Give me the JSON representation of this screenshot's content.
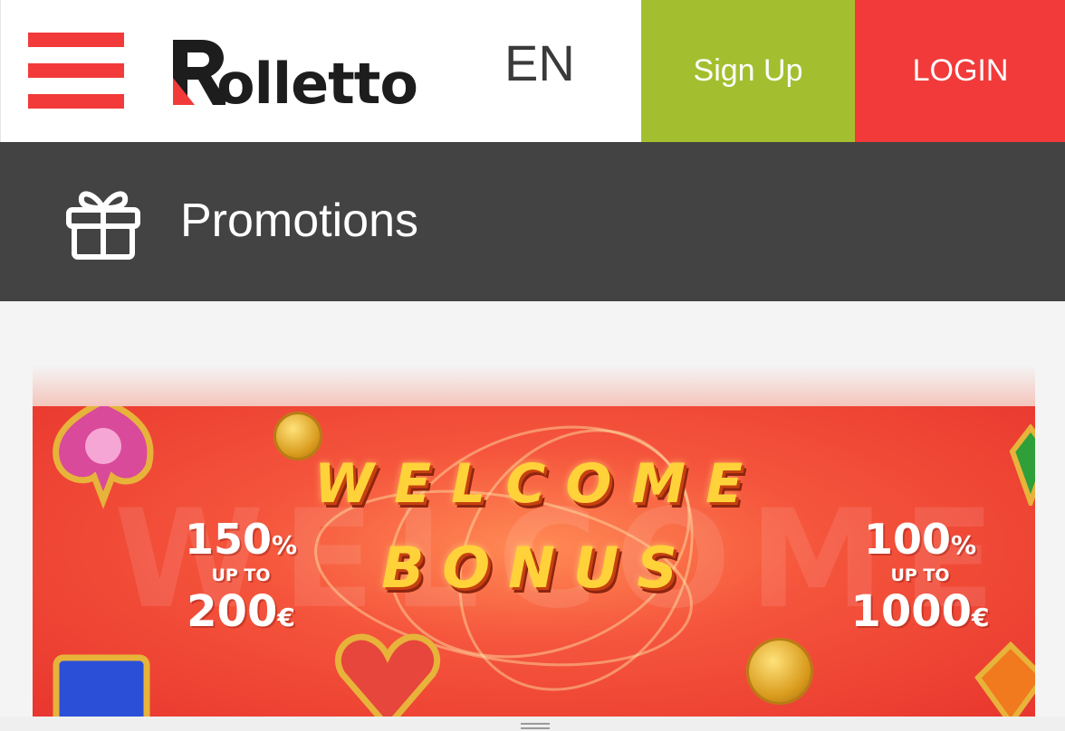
{
  "header": {
    "logo_text": "olletto",
    "language": "EN",
    "signup_label": "Sign Up",
    "login_label": "LOGIN",
    "colors": {
      "brand_red": "#f23a3a",
      "signup_green": "#a3bf2f"
    }
  },
  "section": {
    "title": "Promotions",
    "icon": "gift-icon"
  },
  "banner": {
    "background_word": "WELCOME",
    "line1": "WELCOME",
    "line2": "BONUS",
    "left_offer": {
      "percent": "150",
      "percent_sign": "%",
      "upto": "UP TO",
      "amount": "200",
      "currency": "€"
    },
    "right_offer": {
      "percent": "100",
      "percent_sign": "%",
      "upto": "UP TO",
      "amount": "1000",
      "currency": "€"
    }
  }
}
